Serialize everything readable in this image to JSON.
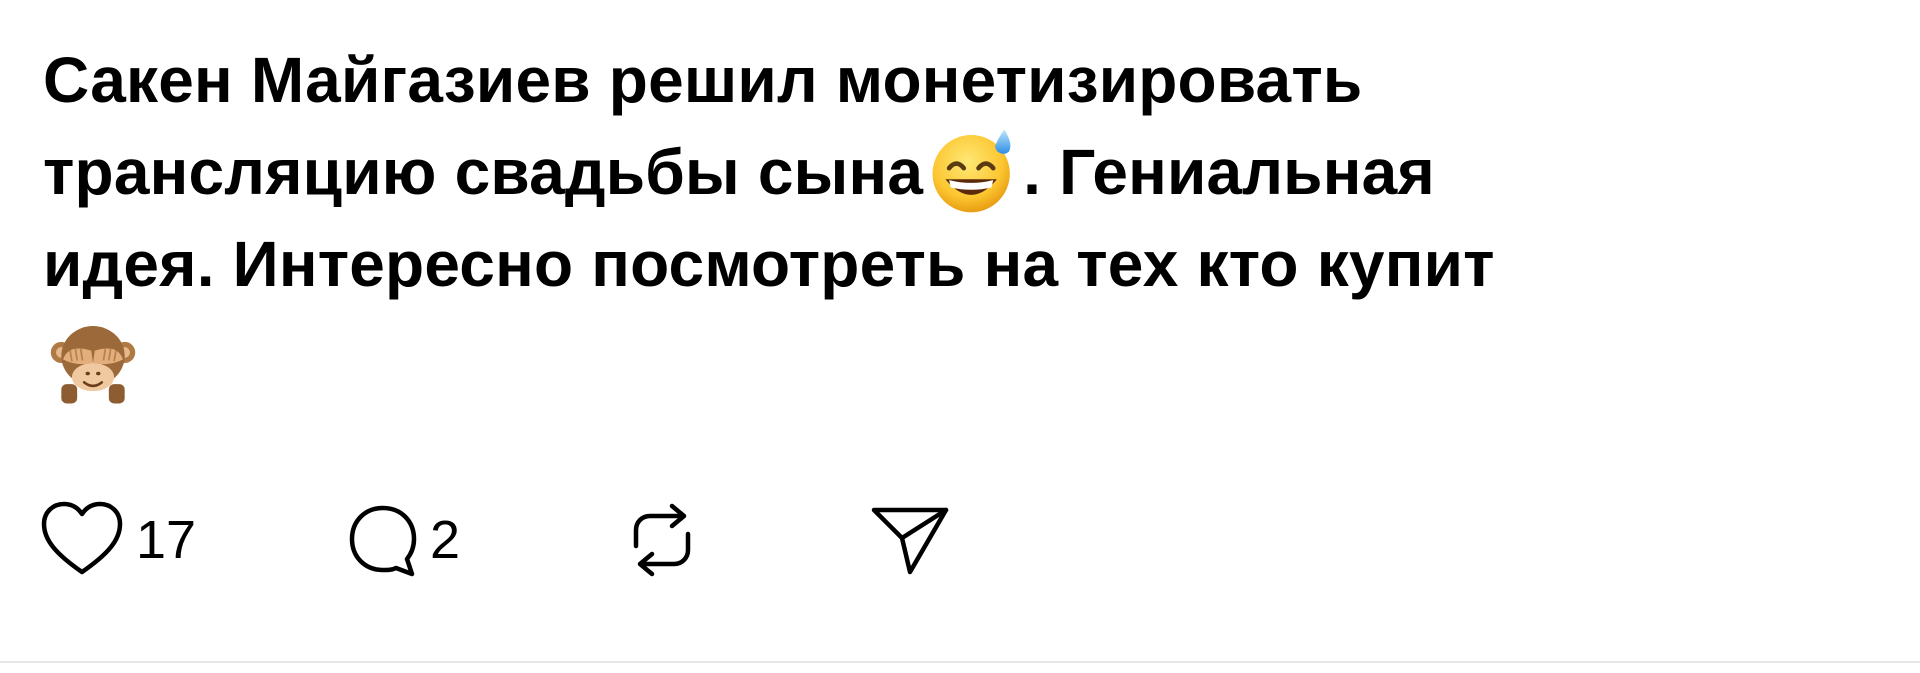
{
  "post": {
    "line1": "Сакен Майгазиев решил монетизировать",
    "line2_before": "трансляцию свадьбы сына",
    "line2_after": ". Гениальная",
    "line3": "идея. Интересно посмотреть на тех кто купит",
    "emoji_1": "grinning-face-with-sweat-emoji",
    "emoji_2": "see-no-evil-monkey-emoji"
  },
  "actions": {
    "likes": "17",
    "comments": "2",
    "like_icon": "heart-icon",
    "comment_icon": "comment-bubble-icon",
    "repost_icon": "repost-icon",
    "share_icon": "send-icon"
  },
  "colors": {
    "text": "#000000",
    "background": "#ffffff",
    "divider": "#e6e6e6"
  }
}
